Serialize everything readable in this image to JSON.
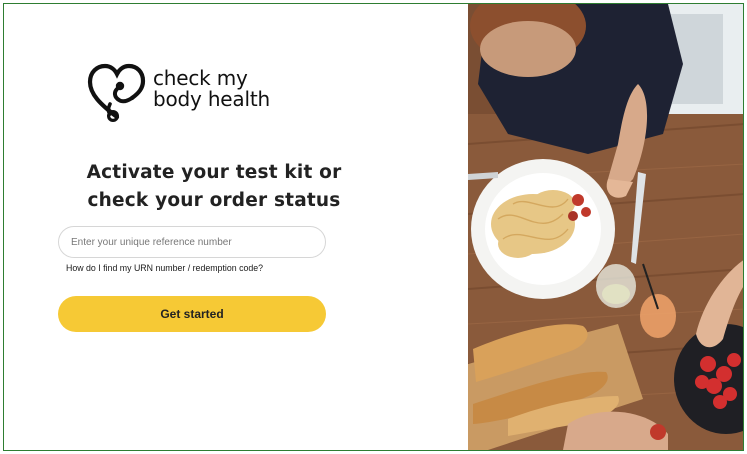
{
  "brand": {
    "name_line1": "check my",
    "name_line2": "body health"
  },
  "activation": {
    "heading_line1": "Activate your test kit or",
    "heading_line2": "check your order status",
    "urn_placeholder": "Enter your unique reference number",
    "urn_value": "",
    "help_link": "How do I find my URN number / redemption code?",
    "cta_label": "Get started"
  },
  "colors": {
    "cta_yellow": "#f6c935",
    "frame_border": "#2e7d32",
    "table_wood": "#8a5a3b",
    "shirt_navy": "#1e2233"
  },
  "icons": {
    "logo": "heart-stethoscope-icon"
  }
}
